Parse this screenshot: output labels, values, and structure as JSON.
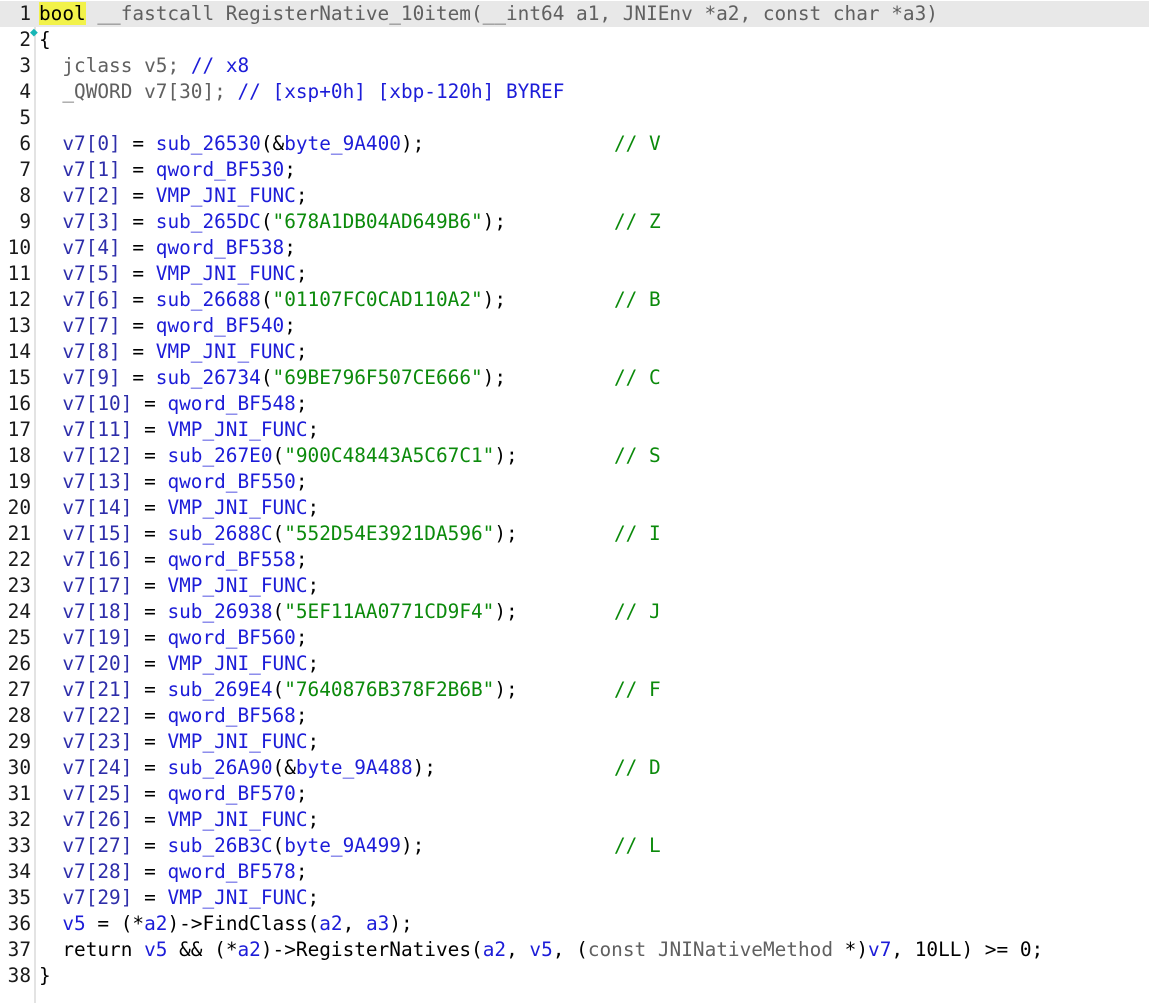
{
  "editor": {
    "signature": {
      "return_type": "bool",
      "callconv": " __fastcall ",
      "name": "RegisterNative_10item",
      "params": "(__int64 a1, JNIEnv *a2, const char *a3)"
    },
    "open_brace": "{",
    "close_brace": "}",
    "decls": [
      {
        "type": "jclass",
        "name": "v5",
        "comment": "// x8"
      },
      {
        "type": "_QWORD",
        "name": "v7[30]",
        "comment": "// [xsp+0h] [xbp-120h] BYREF"
      }
    ],
    "assignments": [
      {
        "lhs": "v7[0]",
        "rhs": "sub_26530(&byte_9A400);",
        "comment": "// V"
      },
      {
        "lhs": "v7[1]",
        "rhs": "qword_BF530;",
        "comment": ""
      },
      {
        "lhs": "v7[2]",
        "rhs": "VMP_JNI_FUNC;",
        "comment": ""
      },
      {
        "lhs": "v7[3]",
        "rhs": "sub_265DC(\"678A1DB04AD649B6\");",
        "comment": "// Z"
      },
      {
        "lhs": "v7[4]",
        "rhs": "qword_BF538;",
        "comment": ""
      },
      {
        "lhs": "v7[5]",
        "rhs": "VMP_JNI_FUNC;",
        "comment": ""
      },
      {
        "lhs": "v7[6]",
        "rhs": "sub_26688(\"01107FC0CAD110A2\");",
        "comment": "// B"
      },
      {
        "lhs": "v7[7]",
        "rhs": "qword_BF540;",
        "comment": ""
      },
      {
        "lhs": "v7[8]",
        "rhs": "VMP_JNI_FUNC;",
        "comment": ""
      },
      {
        "lhs": "v7[9]",
        "rhs": "sub_26734(\"69BE796F507CE666\");",
        "comment": "// C"
      },
      {
        "lhs": "v7[10]",
        "rhs": "qword_BF548;",
        "comment": ""
      },
      {
        "lhs": "v7[11]",
        "rhs": "VMP_JNI_FUNC;",
        "comment": ""
      },
      {
        "lhs": "v7[12]",
        "rhs": "sub_267E0(\"900C48443A5C67C1\");",
        "comment": "// S"
      },
      {
        "lhs": "v7[13]",
        "rhs": "qword_BF550;",
        "comment": ""
      },
      {
        "lhs": "v7[14]",
        "rhs": "VMP_JNI_FUNC;",
        "comment": ""
      },
      {
        "lhs": "v7[15]",
        "rhs": "sub_2688C(\"552D54E3921DA596\");",
        "comment": "// I"
      },
      {
        "lhs": "v7[16]",
        "rhs": "qword_BF558;",
        "comment": ""
      },
      {
        "lhs": "v7[17]",
        "rhs": "VMP_JNI_FUNC;",
        "comment": ""
      },
      {
        "lhs": "v7[18]",
        "rhs": "sub_26938(\"5EF11AA0771CD9F4\");",
        "comment": "// J"
      },
      {
        "lhs": "v7[19]",
        "rhs": "qword_BF560;",
        "comment": ""
      },
      {
        "lhs": "v7[20]",
        "rhs": "VMP_JNI_FUNC;",
        "comment": ""
      },
      {
        "lhs": "v7[21]",
        "rhs": "sub_269E4(\"7640876B378F2B6B\");",
        "comment": "// F"
      },
      {
        "lhs": "v7[22]",
        "rhs": "qword_BF568;",
        "comment": ""
      },
      {
        "lhs": "v7[23]",
        "rhs": "VMP_JNI_FUNC;",
        "comment": ""
      },
      {
        "lhs": "v7[24]",
        "rhs": "sub_26A90(&byte_9A488);",
        "comment": "// D"
      },
      {
        "lhs": "v7[25]",
        "rhs": "qword_BF570;",
        "comment": ""
      },
      {
        "lhs": "v7[26]",
        "rhs": "VMP_JNI_FUNC;",
        "comment": ""
      },
      {
        "lhs": "v7[27]",
        "rhs": "sub_26B3C(byte_9A499);",
        "comment": "// L"
      },
      {
        "lhs": "v7[28]",
        "rhs": "qword_BF578;",
        "comment": ""
      },
      {
        "lhs": "v7[29]",
        "rhs": "VMP_JNI_FUNC;",
        "comment": ""
      }
    ],
    "find_class_line": "v5 = (*a2)->FindClass(a2, a3);",
    "return_line": "return v5 && (*a2)->RegisterNatives(a2, v5, (const JNINativeMethod *)v7, 10LL) >= 0;",
    "line_numbers": [
      "1",
      "2",
      "3",
      "4",
      "5",
      "6",
      "7",
      "8",
      "9",
      "10",
      "11",
      "12",
      "13",
      "14",
      "15",
      "16",
      "17",
      "18",
      "19",
      "20",
      "21",
      "22",
      "23",
      "24",
      "25",
      "26",
      "27",
      "28",
      "29",
      "30",
      "31",
      "32",
      "33",
      "34",
      "35",
      "36",
      "37",
      "38"
    ]
  },
  "colors": {
    "keyword_highlight": "#f2f24a",
    "string": "#0b8a0b",
    "comment": "#0b8a0b",
    "identifier": "#1c1cd8",
    "current_line": "#e8e8e8"
  }
}
